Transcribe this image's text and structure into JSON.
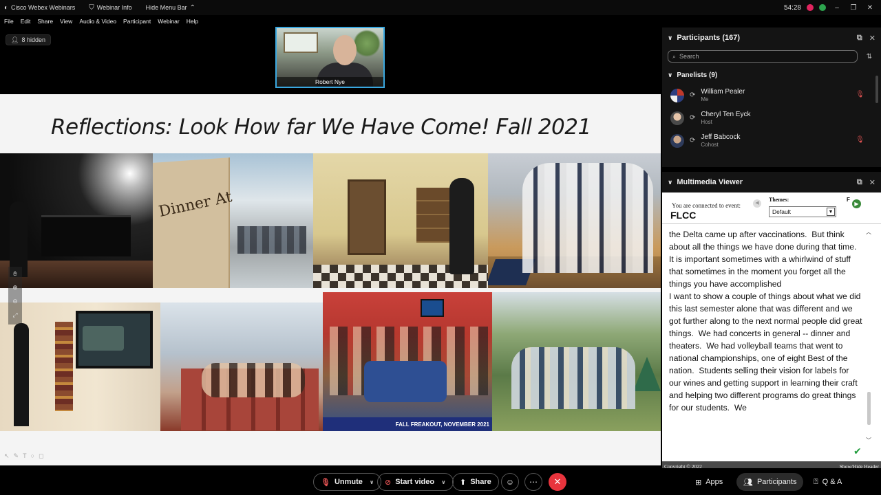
{
  "titlebar": {
    "app_name": "Cisco Webex Webinars",
    "webinar_info": "Webinar Info",
    "hide_menu": "Hide Menu Bar",
    "timer": "54:28"
  },
  "menu": [
    "File",
    "Edit",
    "Share",
    "View",
    "Audio & Video",
    "Participant",
    "Webinar",
    "Help"
  ],
  "hidden_count": "8 hidden",
  "presenter": {
    "name": "Robert Nye"
  },
  "slide": {
    "title": "Reflections: Look How far We Have Come!  Fall 2021",
    "sign_text": "Dinner At",
    "banner_caption": "FALL FREAKOUT, NOVEMBER 2021"
  },
  "participants": {
    "header": "Participants (167)",
    "search_placeholder": "Search",
    "panelists_header": "Panelists (9)",
    "list": [
      {
        "name": "William Pealer",
        "role": "Me",
        "muted": true
      },
      {
        "name": "Cheryl Ten Eyck",
        "role": "Host",
        "muted": false
      },
      {
        "name": "Jeff Babcock",
        "role": "Cohost",
        "muted": true
      }
    ]
  },
  "multimedia": {
    "header": "Multimedia Viewer",
    "connected_label": "You are connected to event:",
    "event_name": "FLCC",
    "themes_label": "Themes:",
    "theme_selected": "Default",
    "f_label": "F",
    "caption_text": "the Delta came up after vaccinations.  But think about all the things we have done during that time.  It is important sometimes with a whirlwind of stuff that sometimes in the moment you forget all the things you have accomplished\nI want to show a couple of things about what we did this last semester alone that was different and we got further along to the next normal people did great things.  We had concerts in general -- dinner and theaters.  We had volleyball teams that went to national championships, one of eight Best of the  nation.  Students selling their vision for labels for our wines and getting support in learning their craft and helping two different programs do great things for our students.  We",
    "copyright": "Copyright © 2022",
    "show_hide": "Show/Hide Header"
  },
  "controls": {
    "unmute": "Unmute",
    "start_video": "Start video",
    "share": "Share",
    "apps": "Apps",
    "participants": "Participants",
    "qa": "Q & A"
  },
  "colors": {
    "accent_border": "#3aa8e0",
    "end_call": "#e8343d",
    "muted_icon": "#e05252"
  }
}
